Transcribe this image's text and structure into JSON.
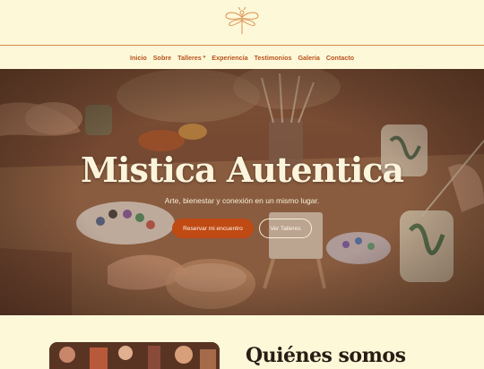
{
  "brand": {
    "logo_icon": "dragonfly-logo-icon",
    "accent": "#d98a4a"
  },
  "nav": {
    "items": [
      {
        "label": "Inicio"
      },
      {
        "label": "Sobre"
      },
      {
        "label": "Talleres",
        "dropdown": true
      },
      {
        "label": "Experiencia"
      },
      {
        "label": "Testimonios"
      },
      {
        "label": "Galeria"
      },
      {
        "label": "Contacto"
      }
    ],
    "caret_icon": "▾"
  },
  "hero": {
    "title": "Mistica Autentica",
    "subtitle": "Arte, bienestar y conexión en un mismo lugar.",
    "primary_button": "Reservar mi encuentro",
    "secondary_button": "Ver Talleres"
  },
  "about": {
    "title": "Quiénes somos"
  },
  "colors": {
    "background": "#fdf8d8",
    "primary": "#c04a14",
    "nav_text": "#b8531e"
  }
}
